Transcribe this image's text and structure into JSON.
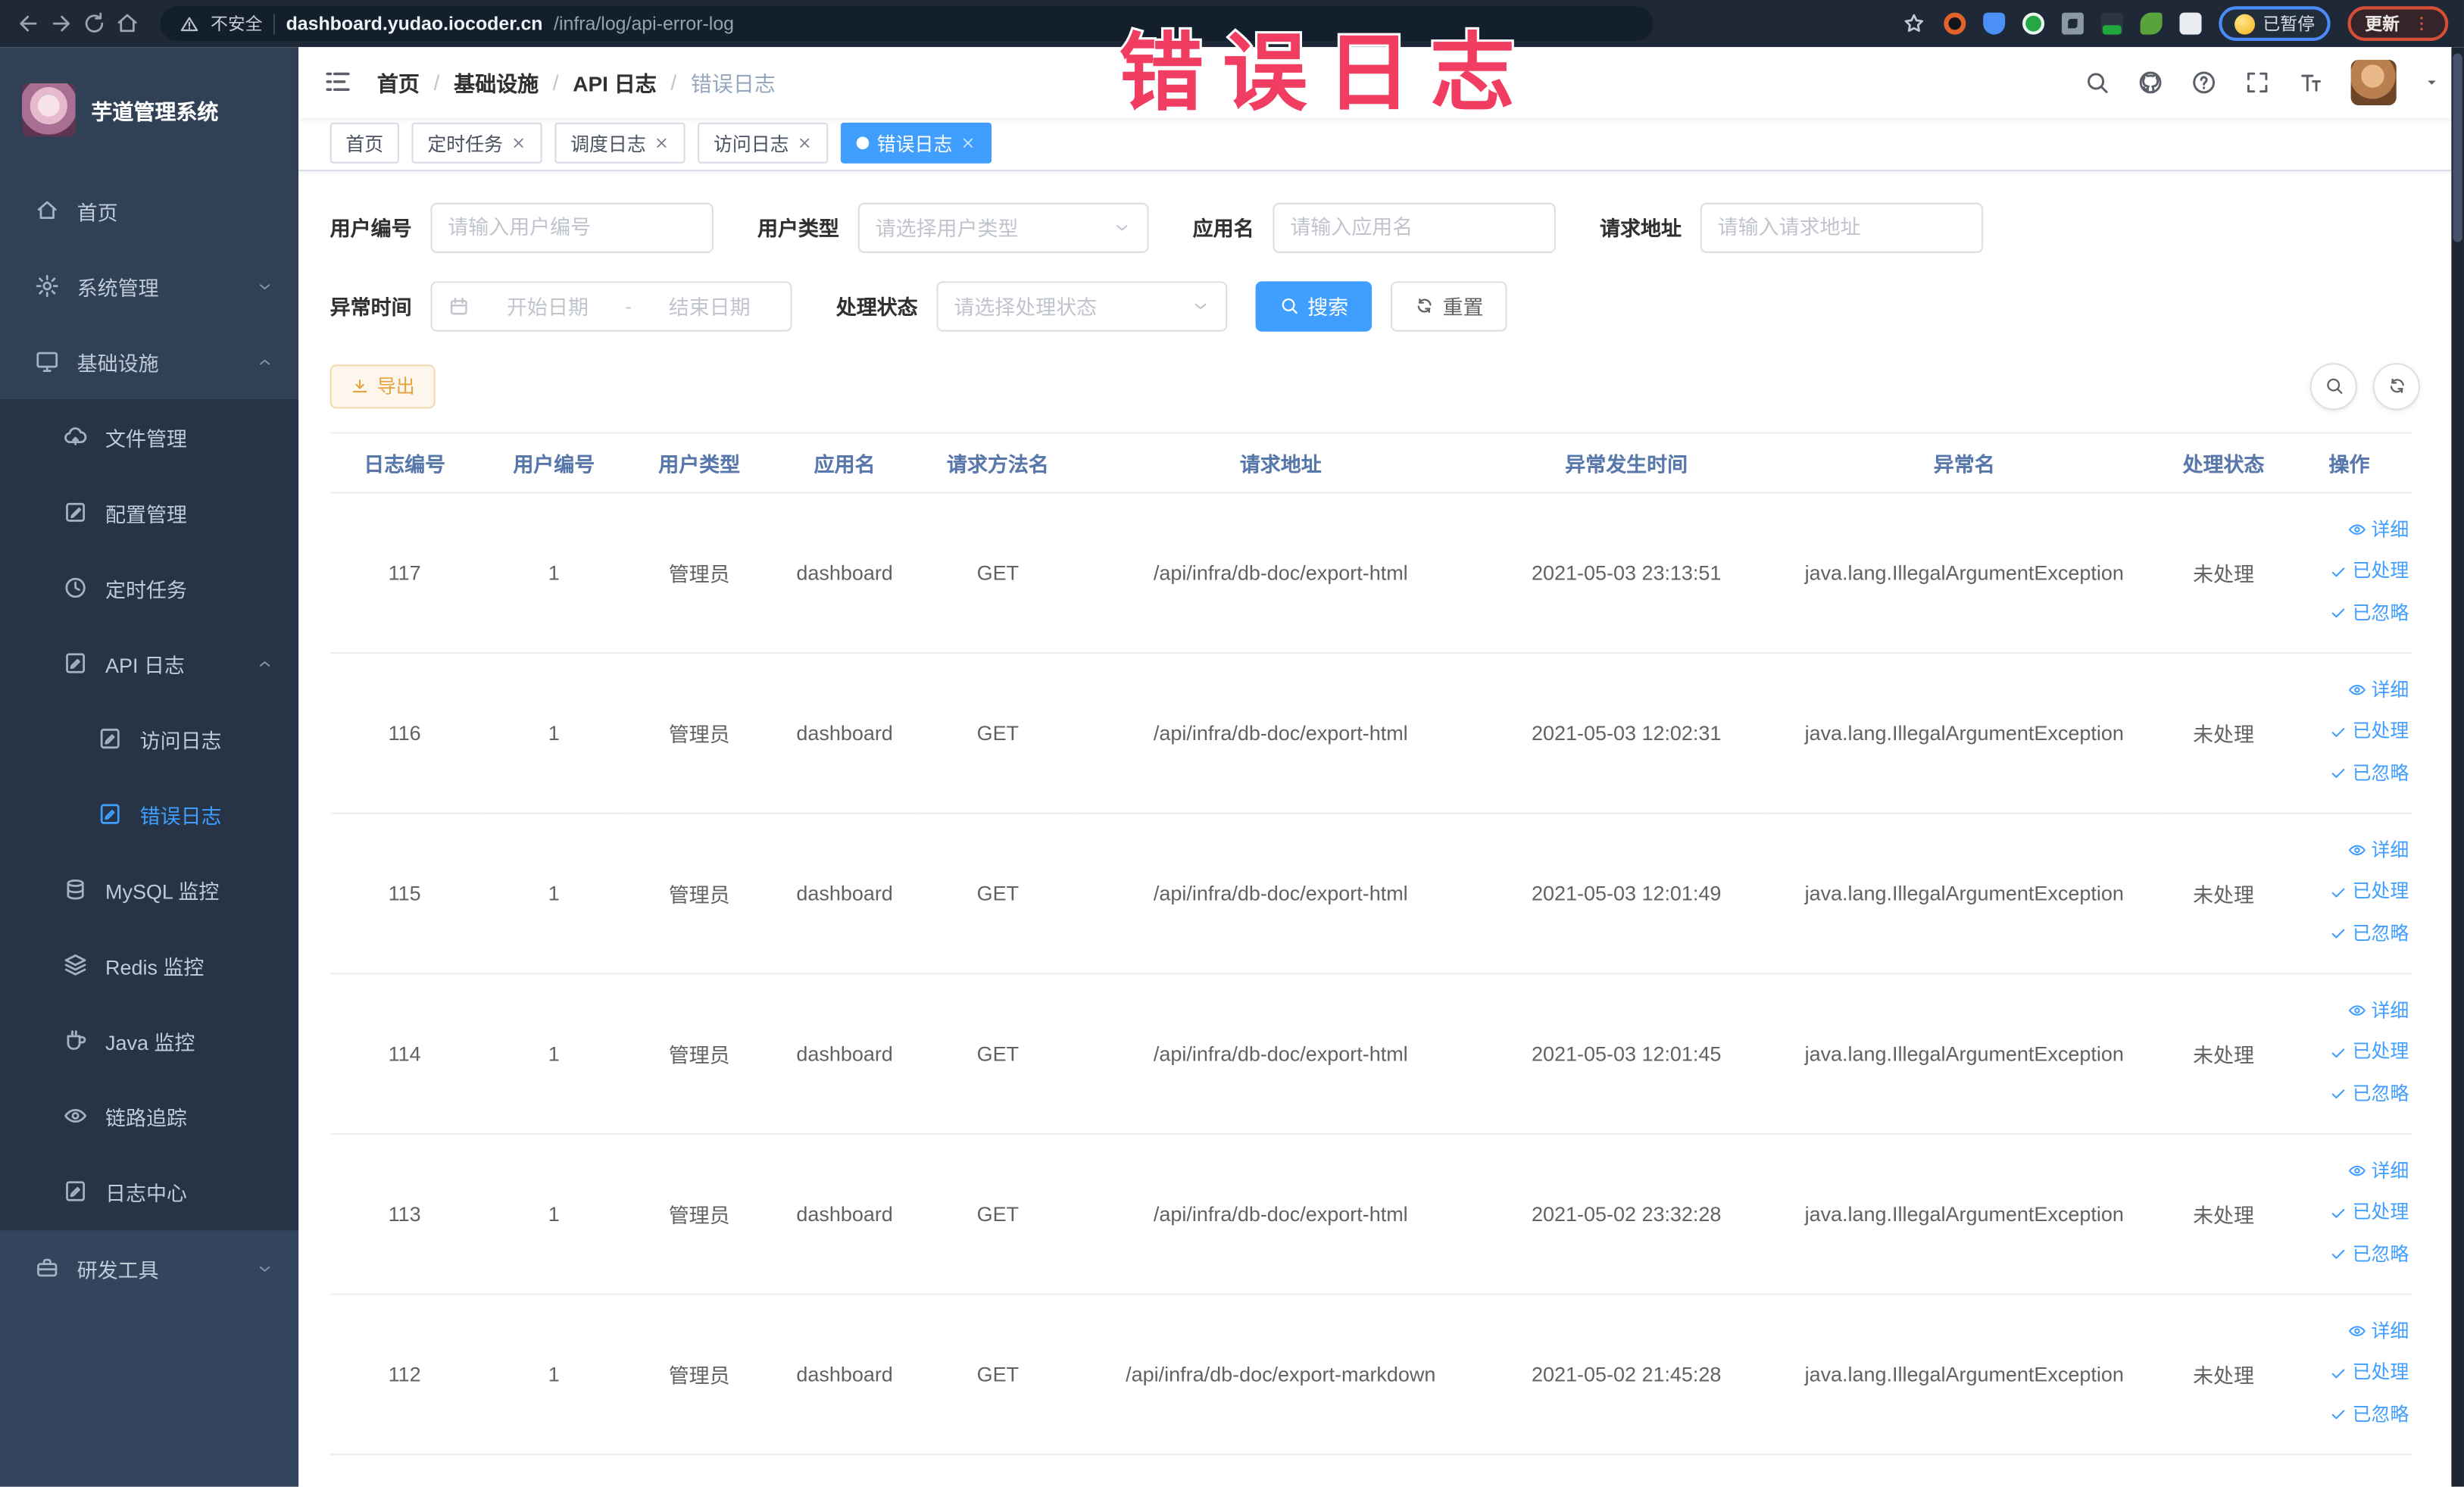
{
  "colors": {
    "accent": "#409EFF",
    "warning": "#E6A23C",
    "sidebar": "#304156",
    "overlay_title": "#F23D62",
    "active_tab_bg": "#409EFF"
  },
  "overlay_title": "错误日志",
  "browser": {
    "security_label": "不安全",
    "url_host": "dashboard.yudao.iocoder.cn",
    "url_path": "/infra/log/api-error-log",
    "paused_badge": "已暂停",
    "update_button": "更新"
  },
  "sidebar": {
    "title": "芋道管理系统",
    "menu": [
      {
        "id": "home",
        "label": "首页",
        "icon": "home",
        "icon_name": "home-icon",
        "level": 1,
        "zone": "top"
      },
      {
        "id": "system",
        "label": "系统管理",
        "icon": "gear",
        "icon_name": "gear-icon",
        "level": 1,
        "zone": "top",
        "chevron": "down"
      },
      {
        "id": "infra",
        "label": "基础设施",
        "icon": "monitor",
        "icon_name": "monitor-icon",
        "level": 1,
        "zone": "top",
        "chevron": "up"
      },
      {
        "id": "file",
        "label": "文件管理",
        "icon": "cloud",
        "icon_name": "cloud-upload-icon",
        "level": 2,
        "zone": "sub"
      },
      {
        "id": "config",
        "label": "配置管理",
        "icon": "edit",
        "icon_name": "edit-icon",
        "level": 2,
        "zone": "sub"
      },
      {
        "id": "job",
        "label": "定时任务",
        "icon": "clock",
        "icon_name": "clock-icon",
        "level": 2,
        "zone": "sub"
      },
      {
        "id": "api-log",
        "label": "API 日志",
        "icon": "docedit",
        "icon_name": "document-icon",
        "level": 2,
        "zone": "sub",
        "chevron": "up"
      },
      {
        "id": "access-log",
        "label": "访问日志",
        "icon": "docedit",
        "icon_name": "document-icon",
        "level": 3,
        "zone": "sub"
      },
      {
        "id": "error-log",
        "label": "错误日志",
        "icon": "docedit",
        "icon_name": "document-icon",
        "level": 3,
        "zone": "sub",
        "active": true
      },
      {
        "id": "mysql",
        "label": "MySQL 监控",
        "icon": "db",
        "icon_name": "database-icon",
        "level": 2,
        "zone": "sub"
      },
      {
        "id": "redis",
        "label": "Redis 监控",
        "icon": "layers",
        "icon_name": "layers-icon",
        "level": 2,
        "zone": "sub"
      },
      {
        "id": "java",
        "label": "Java 监控",
        "icon": "cup",
        "icon_name": "coffee-cup-icon",
        "level": 2,
        "zone": "sub"
      },
      {
        "id": "trace",
        "label": "链路追踪",
        "icon": "eye",
        "icon_name": "eye-icon",
        "level": 2,
        "zone": "sub"
      },
      {
        "id": "log-center",
        "label": "日志中心",
        "icon": "docedit",
        "icon_name": "document-icon",
        "level": 2,
        "zone": "sub"
      },
      {
        "id": "devtools",
        "label": "研发工具",
        "icon": "brief",
        "icon_name": "briefcase-icon",
        "level": 1,
        "zone": "bottom",
        "chevron": "down"
      }
    ]
  },
  "header": {
    "breadcrumb": [
      "首页",
      "基础设施",
      "API 日志",
      "错误日志"
    ]
  },
  "tabs": [
    {
      "label": "首页",
      "closable": false,
      "active": false
    },
    {
      "label": "定时任务",
      "closable": true,
      "active": false
    },
    {
      "label": "调度日志",
      "closable": true,
      "active": false
    },
    {
      "label": "访问日志",
      "closable": true,
      "active": false
    },
    {
      "label": "错误日志",
      "closable": true,
      "active": true
    }
  ],
  "filters": {
    "user_id": {
      "label": "用户编号",
      "placeholder": "请输入用户编号"
    },
    "user_type": {
      "label": "用户类型",
      "placeholder": "请选择用户类型"
    },
    "app_name": {
      "label": "应用名",
      "placeholder": "请输入应用名"
    },
    "request_url": {
      "label": "请求地址",
      "placeholder": "请输入请求地址"
    },
    "exception_time": {
      "label": "异常时间",
      "start_placeholder": "开始日期",
      "separator": "-",
      "end_placeholder": "结束日期"
    },
    "process_status": {
      "label": "处理状态",
      "placeholder": "请选择处理状态"
    },
    "search_label": "搜索",
    "reset_label": "重置"
  },
  "toolbar": {
    "export_label": "导出"
  },
  "table": {
    "columns": [
      {
        "label": "日志编号",
        "key": "id"
      },
      {
        "label": "用户编号",
        "key": "user_id"
      },
      {
        "label": "用户类型",
        "key": "user_type"
      },
      {
        "label": "应用名",
        "key": "app"
      },
      {
        "label": "请求方法名",
        "key": "method"
      },
      {
        "label": "请求地址",
        "key": "url"
      },
      {
        "label": "异常发生时间",
        "key": "time"
      },
      {
        "label": "异常名",
        "key": "exception"
      },
      {
        "label": "处理状态",
        "key": "status"
      },
      {
        "label": "操作",
        "key": "ops"
      }
    ],
    "rows": [
      {
        "id": "117",
        "user_id": "1",
        "user_type": "管理员",
        "app": "dashboard",
        "method": "GET",
        "url": "/api/infra/db-doc/export-html",
        "time": "2021-05-03 23:13:51",
        "exception": "java.lang.IllegalArgumentException",
        "status": "未处理"
      },
      {
        "id": "116",
        "user_id": "1",
        "user_type": "管理员",
        "app": "dashboard",
        "method": "GET",
        "url": "/api/infra/db-doc/export-html",
        "time": "2021-05-03 12:02:31",
        "exception": "java.lang.IllegalArgumentException",
        "status": "未处理"
      },
      {
        "id": "115",
        "user_id": "1",
        "user_type": "管理员",
        "app": "dashboard",
        "method": "GET",
        "url": "/api/infra/db-doc/export-html",
        "time": "2021-05-03 12:01:49",
        "exception": "java.lang.IllegalArgumentException",
        "status": "未处理"
      },
      {
        "id": "114",
        "user_id": "1",
        "user_type": "管理员",
        "app": "dashboard",
        "method": "GET",
        "url": "/api/infra/db-doc/export-html",
        "time": "2021-05-03 12:01:45",
        "exception": "java.lang.IllegalArgumentException",
        "status": "未处理"
      },
      {
        "id": "113",
        "user_id": "1",
        "user_type": "管理员",
        "app": "dashboard",
        "method": "GET",
        "url": "/api/infra/db-doc/export-html",
        "time": "2021-05-02 23:32:28",
        "exception": "java.lang.IllegalArgumentException",
        "status": "未处理"
      },
      {
        "id": "112",
        "user_id": "1",
        "user_type": "管理员",
        "app": "dashboard",
        "method": "GET",
        "url": "/api/infra/db-doc/export-markdown",
        "time": "2021-05-02 21:45:28",
        "exception": "java.lang.IllegalArgumentException",
        "status": "未处理"
      }
    ],
    "row_actions": [
      {
        "name": "detail",
        "label": "详细",
        "icon": "eye"
      },
      {
        "name": "processed",
        "label": "已处理",
        "icon": "check"
      },
      {
        "name": "ignored",
        "label": "已忽略",
        "icon": "check"
      }
    ]
  }
}
